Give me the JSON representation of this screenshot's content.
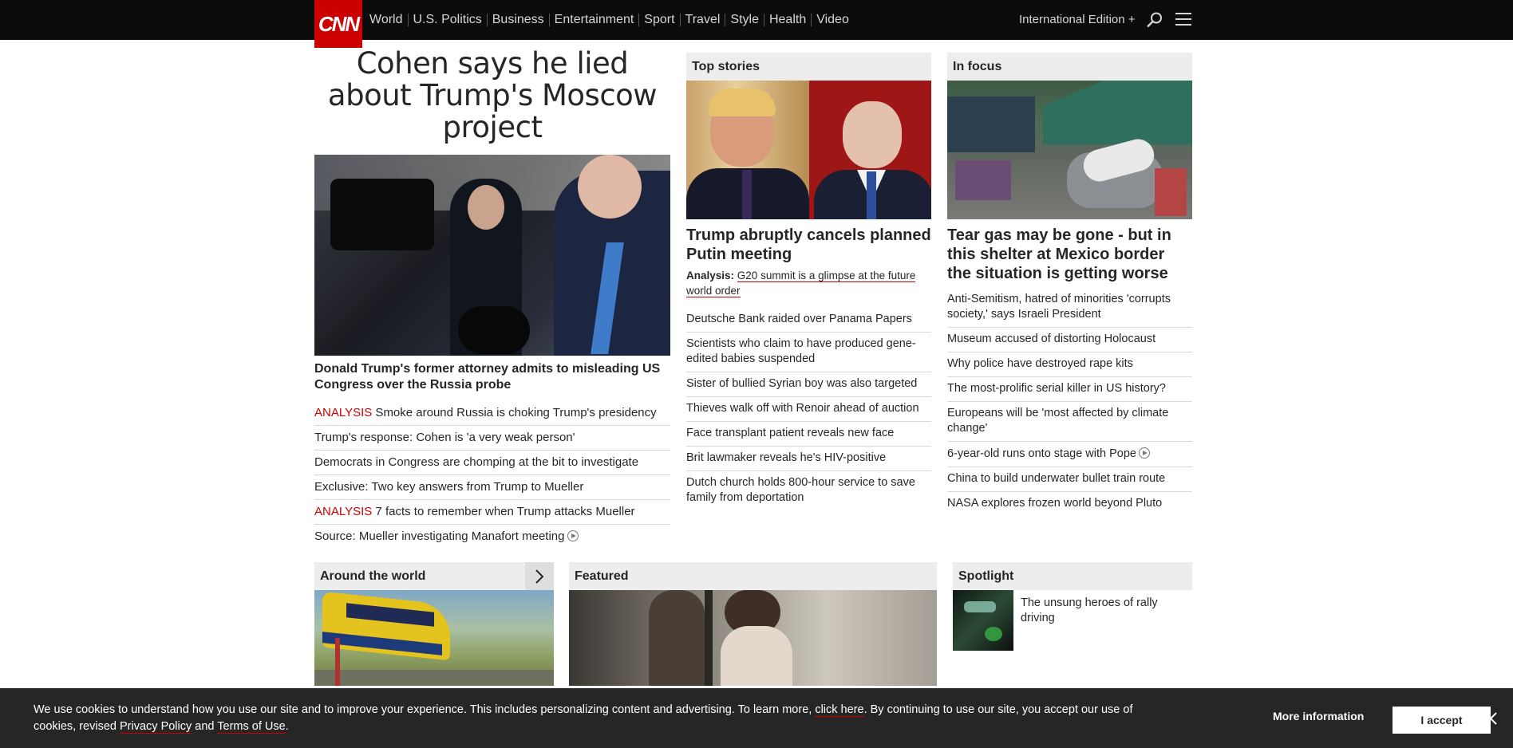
{
  "header": {
    "logo": "CNN",
    "nav": [
      "World",
      "U.S. Politics",
      "Business",
      "Entertainment",
      "Sport",
      "Travel",
      "Style",
      "Health",
      "Video"
    ],
    "edition": "International Edition +"
  },
  "lead": {
    "title": "Cohen says he lied about Trump's Moscow project",
    "subtitle": "Donald Trump's former attorney admits to misleading US Congress over the Russia probe",
    "items": [
      {
        "tag": "ANALYSIS",
        "text": " Smoke around Russia is choking Trump's presidency"
      },
      {
        "tag": "",
        "text": "Trump's response: Cohen is 'a very weak person'"
      },
      {
        "tag": "",
        "text": "Democrats in Congress are chomping at the bit to investigate"
      },
      {
        "tag": "",
        "text": "Exclusive: Two key answers from Trump to Mueller"
      },
      {
        "tag": "ANALYSIS",
        "text": " 7 facts to remember when Trump attacks Mueller"
      },
      {
        "tag": "",
        "text": "Source: Mueller investigating Manafort meeting"
      }
    ]
  },
  "top_stories": {
    "heading": "Top stories",
    "title": "Trump abruptly cancels planned Putin meeting",
    "analysis_label": "Analysis:",
    "analysis_text": "G20 summit is a glimpse at the future world order",
    "items": [
      "Deutsche Bank raided over Panama Papers",
      "Scientists who claim to have produced gene-edited babies suspended",
      "Sister of bullied Syrian boy was also targeted",
      "Thieves walk off with Renoir ahead of auction",
      "Face transplant patient reveals new face",
      "Brit lawmaker reveals he's HIV-positive",
      "Dutch church holds 800-hour service to save family from deportation"
    ]
  },
  "in_focus": {
    "heading": "In focus",
    "title": "Tear gas may be gone - but in this shelter at Mexico border the situation is getting worse",
    "items": [
      "Anti-Semitism, hatred of minorities 'corrupts society,' says Israeli President",
      "Museum accused of distorting Holocaust",
      "Why police have destroyed rape kits",
      "The most-prolific serial killer in US history?",
      "Europeans will be 'most affected by climate change'",
      "6-year-old runs onto stage with Pope",
      "China to build underwater bullet train route",
      "NASA explores frozen world beyond Pluto"
    ]
  },
  "around": {
    "heading": "Around the world"
  },
  "featured": {
    "heading": "Featured"
  },
  "spotlight": {
    "heading": "Spotlight",
    "text": "The unsung heroes of rally driving"
  },
  "cookie": {
    "text_a": "We use cookies to understand how you use our site and to improve your experience. This includes personalizing content and advertising. To learn more, ",
    "link_click": "click here",
    "text_b": ". By continuing to use our site, you accept our use of cookies, revised ",
    "link_privacy": "Privacy Policy",
    "text_c": " and ",
    "link_terms": "Terms of Use",
    "text_d": ".",
    "more_info": "More information",
    "accept": "I accept"
  },
  "colors": {
    "brand": "#cc0000",
    "header_bg": "#0c0c0c",
    "banner_bg": "#262626"
  }
}
